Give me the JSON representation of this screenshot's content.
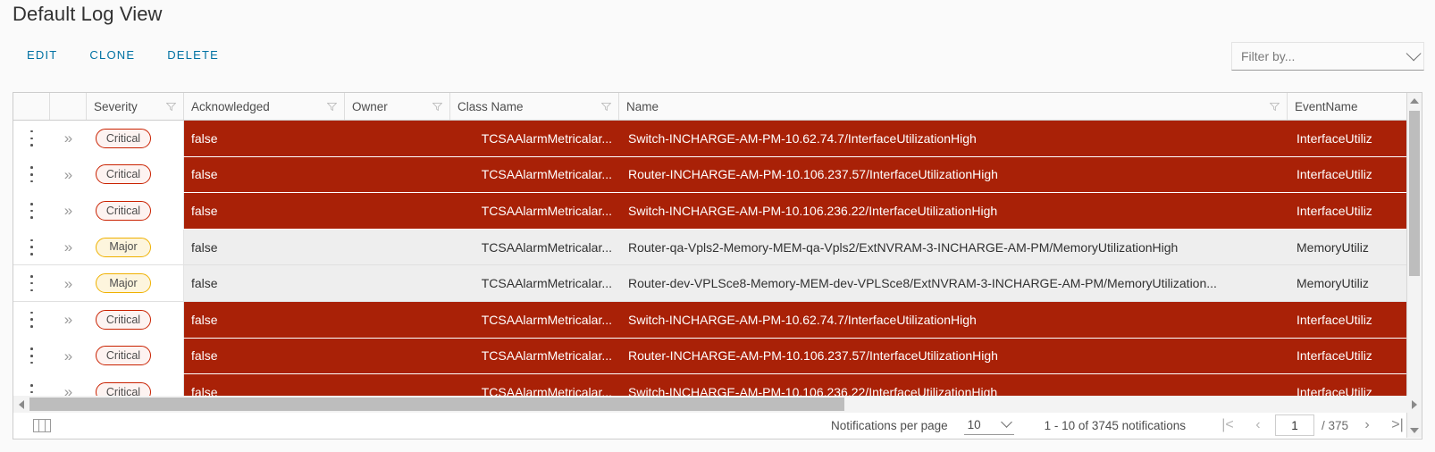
{
  "page_title": "Default Log View",
  "toolbar": {
    "edit_label": "EDIT",
    "clone_label": "CLONE",
    "delete_label": "DELETE"
  },
  "filter": {
    "placeholder": "Filter by...",
    "value": "Filter by...",
    "icon": "chevron-down-icon"
  },
  "table": {
    "columns": [
      {
        "label": "",
        "filterable": false
      },
      {
        "label": "",
        "filterable": false
      },
      {
        "label": "Severity",
        "filterable": true
      },
      {
        "label": "Acknowledged",
        "filterable": true
      },
      {
        "label": "Owner",
        "filterable": true
      },
      {
        "label": "Class Name",
        "filterable": true
      },
      {
        "label": "Name",
        "filterable": true
      },
      {
        "label": "EventName",
        "filterable": false
      }
    ],
    "rows": [
      {
        "severity": "Critical",
        "severity_level": "critical",
        "acknowledged": "false",
        "owner": "",
        "class_name": "TCSAAlarmMetricalar...",
        "name": "Switch-INCHARGE-AM-PM-10.62.74.7/InterfaceUtilizationHigh",
        "event_name": "InterfaceUtiliz"
      },
      {
        "severity": "Critical",
        "severity_level": "critical",
        "acknowledged": "false",
        "owner": "",
        "class_name": "TCSAAlarmMetricalar...",
        "name": "Router-INCHARGE-AM-PM-10.106.237.57/InterfaceUtilizationHigh",
        "event_name": "InterfaceUtiliz"
      },
      {
        "severity": "Critical",
        "severity_level": "critical",
        "acknowledged": "false",
        "owner": "",
        "class_name": "TCSAAlarmMetricalar...",
        "name": "Switch-INCHARGE-AM-PM-10.106.236.22/InterfaceUtilizationHigh",
        "event_name": "InterfaceUtiliz"
      },
      {
        "severity": "Major",
        "severity_level": "major",
        "acknowledged": "false",
        "owner": "",
        "class_name": "TCSAAlarmMetricalar...",
        "name": "Router-qa-Vpls2-Memory-MEM-qa-Vpls2/ExtNVRAM-3-INCHARGE-AM-PM/MemoryUtilizationHigh",
        "event_name": "MemoryUtiliz"
      },
      {
        "severity": "Major",
        "severity_level": "major",
        "acknowledged": "false",
        "owner": "",
        "class_name": "TCSAAlarmMetricalar...",
        "name": "Router-dev-VPLSce8-Memory-MEM-dev-VPLSce8/ExtNVRAM-3-INCHARGE-AM-PM/MemoryUtilization...",
        "event_name": "MemoryUtiliz"
      },
      {
        "severity": "Critical",
        "severity_level": "critical",
        "acknowledged": "false",
        "owner": "",
        "class_name": "TCSAAlarmMetricalar...",
        "name": "Switch-INCHARGE-AM-PM-10.62.74.7/InterfaceUtilizationHigh",
        "event_name": "InterfaceUtiliz"
      },
      {
        "severity": "Critical",
        "severity_level": "critical",
        "acknowledged": "false",
        "owner": "",
        "class_name": "TCSAAlarmMetricalar...",
        "name": "Router-INCHARGE-AM-PM-10.106.237.57/InterfaceUtilizationHigh",
        "event_name": "InterfaceUtiliz"
      },
      {
        "severity": "Critical",
        "severity_level": "critical",
        "acknowledged": "false",
        "owner": "",
        "class_name": "TCSAAlarmMetricalar...",
        "name": "Switch-INCHARGE-AM-PM-10.106.236.22/InterfaceUtilizationHigh",
        "event_name": "InterfaceUtiliz"
      }
    ]
  },
  "footer": {
    "column_toggle_icon": "columns-icon",
    "per_page_label": "Notifications per page",
    "per_page_value": "10",
    "range_text": "1 - 10 of 3745 notifications",
    "first_label": "|<",
    "prev_label": "‹",
    "next_label": "›",
    "last_label": ">|",
    "current_page": "1",
    "total_pages": "/ 375"
  },
  "colors": {
    "critical_row": "#a92107",
    "major_row": "#eeeeee",
    "critical_badge_border": "#c92100",
    "major_badge_border": "#efb100",
    "link": "#0072a3"
  }
}
